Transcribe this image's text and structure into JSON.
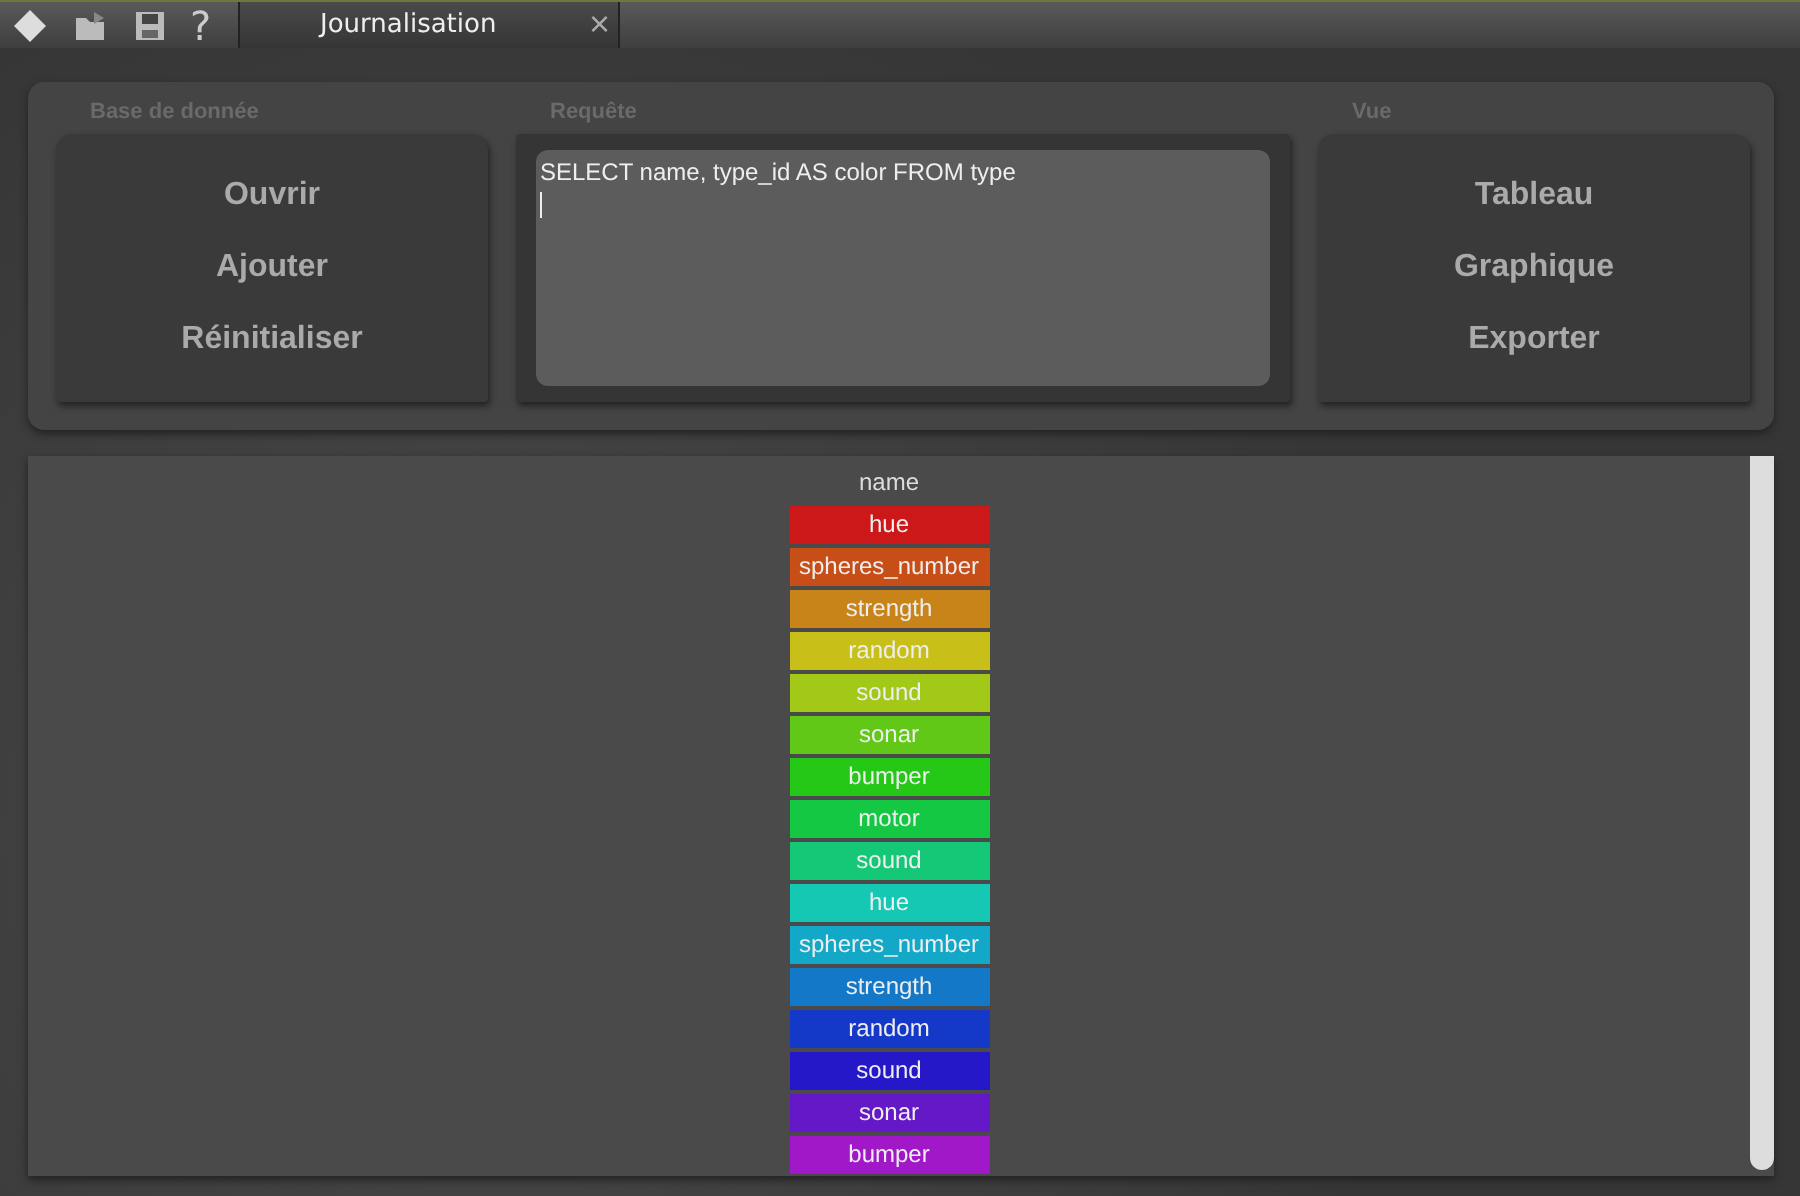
{
  "toolbar": {
    "help": "?"
  },
  "tabs": [
    {
      "label": "Journalisation",
      "close": "×",
      "selected": true
    }
  ],
  "groups": [
    {
      "kind": "buttons",
      "title": "Base de donnée",
      "buttons": [
        "Ouvrir",
        "Ajouter",
        "Réinitialiser"
      ]
    },
    {
      "kind": "query",
      "title": "Requête",
      "value": "SELECT name, type_id AS color FROM type"
    },
    {
      "kind": "buttons",
      "title": "Vue",
      "buttons": [
        "Tableau",
        "Graphique",
        "Exporter"
      ]
    }
  ],
  "table": {
    "columns": [
      "name"
    ],
    "rows": [
      {
        "name": "hue",
        "color": "#cc1818"
      },
      {
        "name": "spheres_number",
        "color": "#c84e18"
      },
      {
        "name": "strength",
        "color": "#c88418"
      },
      {
        "name": "random",
        "color": "#c8c018"
      },
      {
        "name": "sound",
        "color": "#a2c818"
      },
      {
        "name": "sonar",
        "color": "#62c818"
      },
      {
        "name": "bumper",
        "color": "#26c818"
      },
      {
        "name": "motor",
        "color": "#14c844"
      },
      {
        "name": "sound",
        "color": "#14c878"
      },
      {
        "name": "hue",
        "color": "#14c8b4"
      },
      {
        "name": "spheres_number",
        "color": "#14a8c8"
      },
      {
        "name": "strength",
        "color": "#1478c8"
      },
      {
        "name": "random",
        "color": "#1438c8"
      },
      {
        "name": "sound",
        "color": "#2418c8"
      },
      {
        "name": "sonar",
        "color": "#6418c8"
      },
      {
        "name": "bumper",
        "color": "#a018c8"
      }
    ]
  }
}
